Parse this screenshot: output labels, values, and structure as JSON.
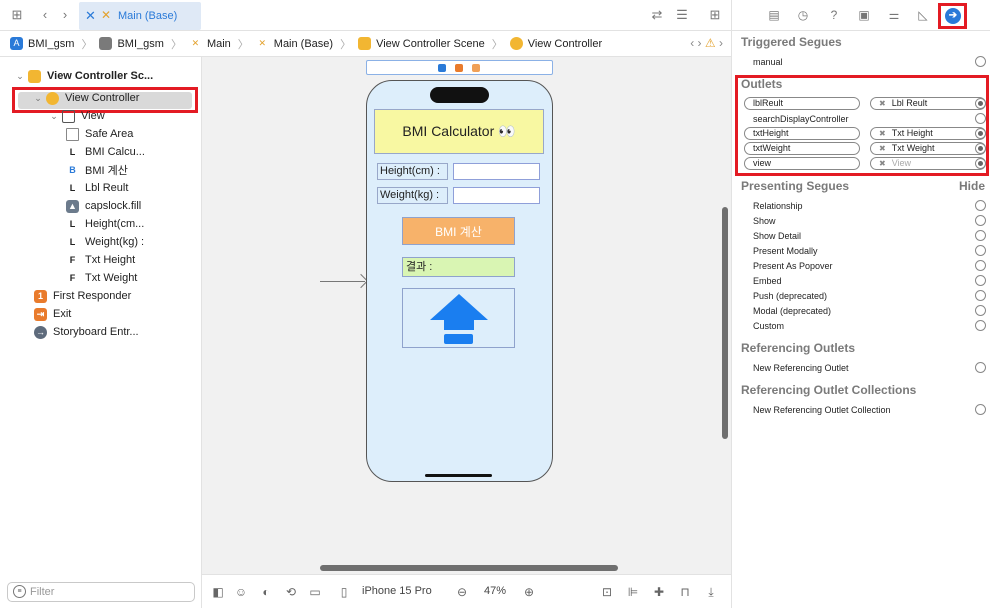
{
  "tabbar": {
    "active_tab": "Main (Base)"
  },
  "breadcrumb": [
    "BMI_gsm",
    "BMI_gsm",
    "Main",
    "Main (Base)",
    "View Controller Scene",
    "View Controller"
  ],
  "outline": {
    "items": [
      {
        "label": "View Controller Sc...",
        "icon": "scene-icon"
      },
      {
        "label": "View Controller",
        "icon": "view-controller-icon"
      },
      {
        "label": "View",
        "icon": "view-icon"
      },
      {
        "label": "Safe Area",
        "icon": "safe-area-icon"
      },
      {
        "label": "BMI Calcu...",
        "icon": "L"
      },
      {
        "label": "BMI 계산",
        "icon": "B"
      },
      {
        "label": "Lbl Reult",
        "icon": "L"
      },
      {
        "label": "capslock.fill",
        "icon": "image-icon"
      },
      {
        "label": "Height(cm...",
        "icon": "L"
      },
      {
        "label": "Weight(kg) :",
        "icon": "L"
      },
      {
        "label": "Txt Height",
        "icon": "F"
      },
      {
        "label": "Txt Weight",
        "icon": "F"
      },
      {
        "label": "First Responder",
        "icon": "1"
      },
      {
        "label": "Exit",
        "icon": "exit-icon"
      },
      {
        "label": "Storyboard Entr...",
        "icon": "arrow-icon"
      }
    ],
    "filter_placeholder": "Filter"
  },
  "canvas": {
    "title": "BMI Calculator 👀",
    "height_label": "Height(cm) :",
    "weight_label": "Weight(kg) :",
    "button_label": "BMI 계산",
    "result_label": "결과 :"
  },
  "bottombar": {
    "device": "iPhone 15 Pro",
    "zoom": "47%"
  },
  "inspector": {
    "triggered_segues_title": "Triggered Segues",
    "triggered_segues": [
      "manual"
    ],
    "outlets_title": "Outlets",
    "outlets": [
      {
        "name": "lblReult",
        "target": "Lbl Reult",
        "connected": true
      },
      {
        "name": "searchDisplayController",
        "target": "",
        "connected": false
      },
      {
        "name": "txtHeight",
        "target": "Txt Height",
        "connected": true
      },
      {
        "name": "txtWeight",
        "target": "Txt Weight",
        "connected": true
      },
      {
        "name": "view",
        "target": "View",
        "connected": true
      }
    ],
    "presenting_segues_title": "Presenting Segues",
    "presenting_segues_hide": "Hide",
    "presenting_segues": [
      "Relationship",
      "Show",
      "Show Detail",
      "Present Modally",
      "Present As Popover",
      "Embed",
      "Push (deprecated)",
      "Modal (deprecated)",
      "Custom"
    ],
    "referencing_outlets_title": "Referencing Outlets",
    "referencing_outlets": [
      "New Referencing Outlet"
    ],
    "referencing_collections_title": "Referencing Outlet Collections",
    "referencing_collections": [
      "New Referencing Outlet Collection"
    ]
  }
}
